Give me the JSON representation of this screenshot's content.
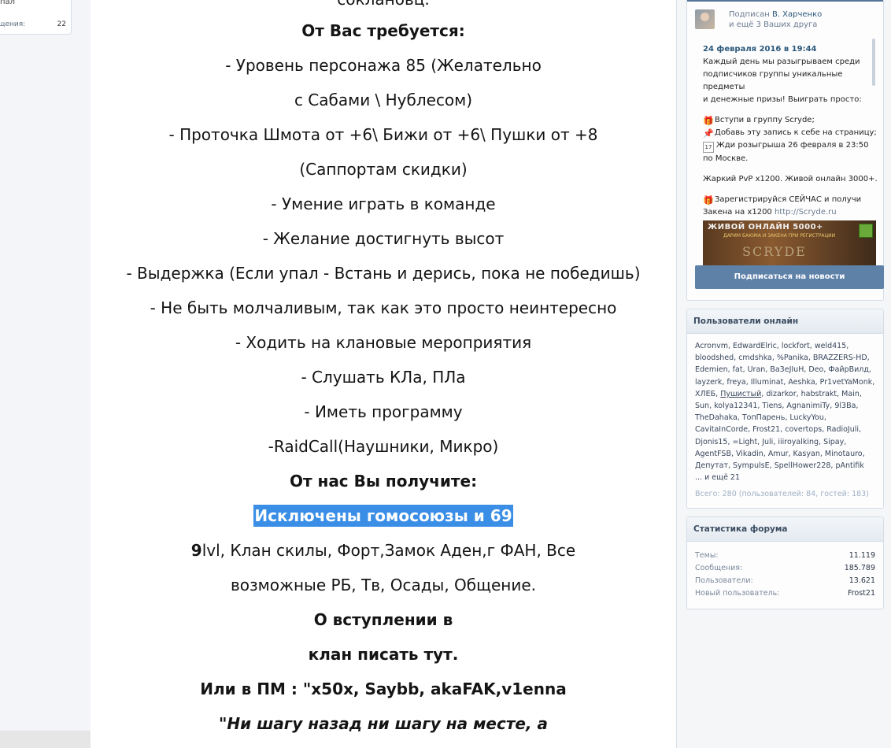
{
  "left": {
    "top_text": "пал",
    "row_label": "щения:",
    "row_value": "22"
  },
  "article": {
    "lines": [
      "соклановц.",
      "От Вас требуется:",
      "- Уровень персонажа 85 (Желательно",
      "с Сабами \\ Нублесом)",
      "- Проточка Шмота от +6\\ Бижи от +6\\ Пушки от +8",
      "(Саппортам скидки)",
      "- Умение играть в команде",
      "- Желание достигнуть высот",
      "- Выдержка (Если упал - Встань и дерись, пока не победишь)",
      "- Не быть молчаливым, так как это просто неинтересно",
      "- Ходить на клановые мероприятия",
      "- Слушать КЛа, ПЛа",
      "- Иметь программу",
      "-RaidCall(Наушники, Микро)",
      "От нас Вы получите:",
      "Исключены гомосоюзы и 69",
      "lvl, Клан скилы, Форт,Замок Аден,г ФАН, Все",
      "возможные РБ, Тв, Осады, Общение.",
      "О вступлении в",
      "клан писать тут.",
      "Или в ПМ : \"x50x, Saybb, akaFAK,v1enna",
      "\"Ни шагу назад ни шагу на месте, а"
    ],
    "bold_prefix": "9"
  },
  "vk": {
    "follow_prefix": "Подписан",
    "follow_name": "В. Харченко",
    "follow_suffix": "и ещё 3 Ваших друга",
    "post_date": "24 февраля 2016 в 19:44",
    "post_lines": [
      "Каждый день мы разыгрываем среди",
      "подписчиков группы уникальные предметы",
      "и денежные призы! Выиграть просто:",
      "Вступи в группу Scryde;",
      "Добавь эту запись к себе на страницу;",
      "Жди розыгрыша 26 февраля в 23:50",
      "по Москве.",
      "Жаркий PvP x1200. Живой онлайн 3000+.",
      "Зарегистрируйся СЕЙЧАС и получи",
      "Закена на x1200 ",
      "http://Scryde.ru"
    ],
    "cal_day": "17",
    "banner_title": "ЖИВОЙ ОНЛАЙН 5000+",
    "banner_sub": "ДАРИМ БАЮМА И ЗАКЕНА ПРИ РЕГИСТРАЦИИ",
    "banner_logo": "SCRYDE",
    "subscribe": "Подписаться на новости"
  },
  "online": {
    "title": "Пользователи онлайн",
    "users_before": "Acronvm, EdwardElric, lockfort, weld415, bloodshed, cmdshka, %Panika, BRAZZERS-HD, Edemien, fat, Uran, Ba3eJIuH, Deo, ФайрВилд, layzerk, freya, Illuminat, Aeshka, Pr1vetYaMonk, ХЛЕБ, ",
    "underlined_user": "Пушистый",
    "users_after": ", dizarkor, habstrakt, Main, Sun, kolya12341, Tiens, AgnanimiTy, 9l3Ba, TheDahaka, ТопПарень, LuckyYou, CavitaInCorde, Frost21, covertops, RadioJuli, Djonis15, =Light, Juli, iiiroyalking, Sipay, AgentFSB, Vikadin, Amur, Kasyan, Minotauro, Депутат, SympulsE, SpellHower228, pAntifik",
    "more": "... и ещё 21",
    "total": "Всего: 280 (пользователей: 84, гостей: 183)"
  },
  "stats": {
    "title": "Статистика форума",
    "rows": [
      {
        "label": "Темы:",
        "value": "11.119"
      },
      {
        "label": "Сообщения:",
        "value": "185.789"
      },
      {
        "label": "Пользователи:",
        "value": "13.621"
      },
      {
        "label": "Новый пользователь:",
        "value": "Frost21"
      }
    ]
  }
}
